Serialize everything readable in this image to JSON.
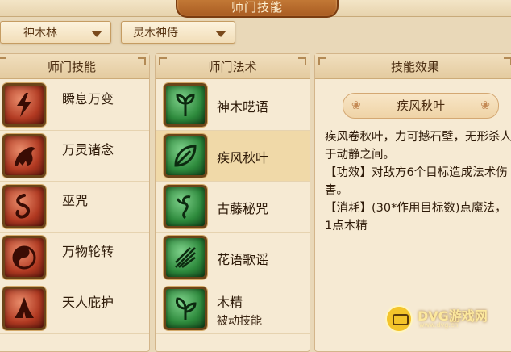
{
  "window": {
    "title": "师门技能"
  },
  "dropdowns": [
    {
      "selected": "神木林"
    },
    {
      "selected": "灵木神侍"
    }
  ],
  "panels": {
    "sect_skills": {
      "header": "师门技能",
      "items": [
        {
          "label": "瞬息万变",
          "icon": "lightning-icon"
        },
        {
          "label": "万灵诸念",
          "icon": "beast-icon"
        },
        {
          "label": "巫咒",
          "icon": "serpent-icon"
        },
        {
          "label": "万物轮转",
          "icon": "yin-yang-icon"
        },
        {
          "label": "天人庇护",
          "icon": "praying-hands-icon"
        }
      ]
    },
    "sect_spells": {
      "header": "师门法术",
      "selected_index": 1,
      "items": [
        {
          "label": "神木呓语",
          "icon": "sprout-icon"
        },
        {
          "label": "疾风秋叶",
          "icon": "leaf-icon"
        },
        {
          "label": "古藤秘咒",
          "icon": "vine-icon"
        },
        {
          "label": "花语歌谣",
          "icon": "flower-icon"
        },
        {
          "label": "木精",
          "sub": "被动技能",
          "icon": "seedling-icon"
        }
      ]
    },
    "skill_effect": {
      "header": "技能效果",
      "name": "疾风秋叶",
      "description": "疾风卷秋叶，力可撼石壁，无形杀人于动静之间。",
      "effect": "【功效】对敌方6个目标造成法术伤害。",
      "cost": "【消耗】(30*作用目标数)点魔法，1点木精"
    }
  },
  "watermark": {
    "text": "DVG游戏网",
    "sub": "www.dvg.cn"
  },
  "colors": {
    "background": "#e9d8b8",
    "accent": "#a95c22",
    "selected_row": "#f0d9a8"
  }
}
